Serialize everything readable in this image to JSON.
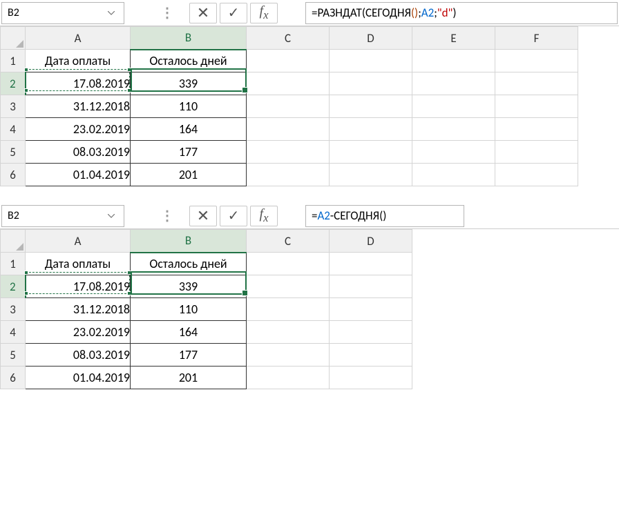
{
  "top": {
    "namebox": "B2",
    "formula_parts": [
      {
        "t": "=РАЗНДАТ",
        "c": "black"
      },
      {
        "t": "(",
        "c": "black"
      },
      {
        "t": "СЕГОДНЯ",
        "c": "black"
      },
      {
        "t": "()",
        "c": "brown"
      },
      {
        "t": ";",
        "c": "black"
      },
      {
        "t": "A2",
        "c": "blue"
      },
      {
        "t": ";",
        "c": "black"
      },
      {
        "t": "\"d\"",
        "c": "red"
      },
      {
        "t": ")",
        "c": "black"
      }
    ],
    "cols": [
      "A",
      "B",
      "C",
      "D",
      "E",
      "F"
    ],
    "rows": [
      "1",
      "2",
      "3",
      "4",
      "5",
      "6"
    ],
    "headers": [
      "Дата оплаты",
      "Осталось дней"
    ],
    "data": [
      [
        "17.08.2019",
        "339"
      ],
      [
        "31.12.2018",
        "110"
      ],
      [
        "23.02.2019",
        "164"
      ],
      [
        "08.03.2019",
        "177"
      ],
      [
        "01.04.2019",
        "201"
      ]
    ]
  },
  "bottom": {
    "namebox": "B2",
    "formula_parts": [
      {
        "t": "=",
        "c": "black"
      },
      {
        "t": "A2",
        "c": "blue"
      },
      {
        "t": "-СЕГОДНЯ",
        "c": "black"
      },
      {
        "t": "()",
        "c": "black"
      }
    ],
    "cols": [
      "A",
      "B",
      "C",
      "D"
    ],
    "rows": [
      "1",
      "2",
      "3",
      "4",
      "5",
      "6"
    ],
    "headers": [
      "Дата оплаты",
      "Осталось дней"
    ],
    "data": [
      [
        "17.08.2019",
        "339"
      ],
      [
        "31.12.2018",
        "110"
      ],
      [
        "23.02.2019",
        "164"
      ],
      [
        "08.03.2019",
        "177"
      ],
      [
        "01.04.2019",
        "201"
      ]
    ]
  }
}
